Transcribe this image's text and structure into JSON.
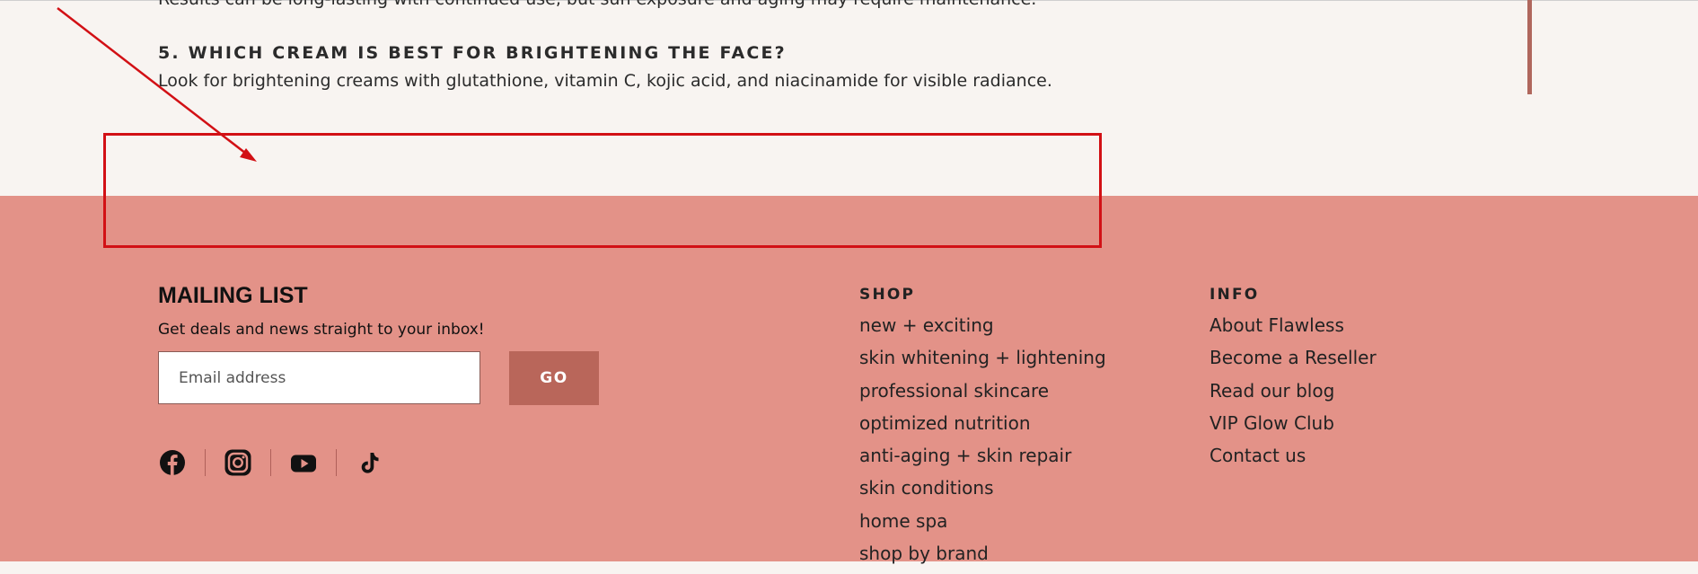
{
  "faq": {
    "cut_answer": "Results can be long-lasting with continued use, but sun exposure and aging may require maintenance.",
    "question_5": "5. WHICH CREAM IS BEST FOR BRIGHTENING THE FACE?",
    "answer_5": "Look for brightening creams with glutathione, vitamin C, kojic acid, and niacinamide for visible radiance."
  },
  "mailing": {
    "title": "MAILING LIST",
    "subtitle": "Get deals and news straight to your inbox!",
    "email_placeholder": "Email address",
    "email_value": "",
    "go_label": "GO"
  },
  "social": {
    "icons": [
      "facebook-icon",
      "instagram-icon",
      "youtube-icon",
      "tiktok-icon"
    ]
  },
  "shop": {
    "heading": "SHOP",
    "items": [
      "new + exciting",
      "skin whitening + lightening",
      "professional skincare",
      "optimized nutrition",
      "anti-aging + skin repair",
      "skin conditions",
      "home spa",
      "shop by brand"
    ]
  },
  "info": {
    "heading": "INFO",
    "items": [
      "About Flawless",
      "Become a Reseller",
      "Read our blog",
      "VIP Glow Club",
      "Contact us"
    ]
  },
  "colors": {
    "page_bg": "#f8f4f1",
    "footer_bg": "#e39288",
    "button_bg": "#b9665a",
    "annotation_red": "#d21015"
  }
}
